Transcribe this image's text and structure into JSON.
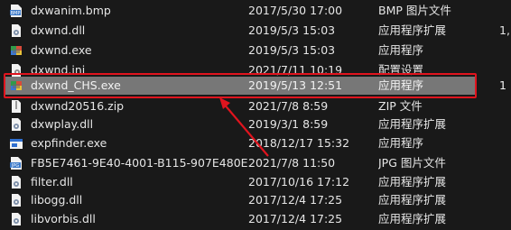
{
  "files": [
    {
      "name": "dxwanim.bmp",
      "date": "2017/5/30 17:00",
      "type": "BMP 图片文件",
      "size": "",
      "icon": "bmp-icon"
    },
    {
      "name": "dxwnd.dll",
      "date": "2019/5/3 15:03",
      "type": "应用程序扩展",
      "size": "1,",
      "icon": "dll-icon"
    },
    {
      "name": "dxwnd.exe",
      "date": "2019/5/3 15:03",
      "type": "应用程序",
      "size": "",
      "icon": "exe-app-icon"
    },
    {
      "name": "dxwnd.ini",
      "date": "2021/7/11 10:19",
      "type": "配置设置",
      "size": "",
      "icon": "ini-icon"
    },
    {
      "name": "dxwnd_CHS.exe",
      "date": "2019/5/13 12:51",
      "type": "应用程序",
      "size": "1",
      "icon": "exe-app-icon"
    },
    {
      "name": "dxwnd20516.zip",
      "date": "2021/7/8 8:59",
      "type": "ZIP 文件",
      "size": "",
      "icon": "zip-icon"
    },
    {
      "name": "dxwplay.dll",
      "date": "2019/3/1 8:59",
      "type": "应用程序扩展",
      "size": "",
      "icon": "dll-icon"
    },
    {
      "name": "expfinder.exe",
      "date": "2018/12/17 15:32",
      "type": "应用程序",
      "size": "",
      "icon": "exe-window-icon"
    },
    {
      "name": "FB5E7461-9E40-4001-B115-907E480E...",
      "date": "2021/7/8 11:50",
      "type": "JPG 图片文件",
      "size": "",
      "icon": "jpg-icon"
    },
    {
      "name": "filter.dll",
      "date": "2017/10/16 17:12",
      "type": "应用程序扩展",
      "size": "",
      "icon": "dll-icon"
    },
    {
      "name": "libogg.dll",
      "date": "2017/12/4 17:25",
      "type": "应用程序扩展",
      "size": "",
      "icon": "dll-icon"
    },
    {
      "name": "libvorbis.dll",
      "date": "2017/12/4 17:25",
      "type": "应用程序扩展",
      "size": "",
      "icon": "dll-icon"
    }
  ],
  "selected_index": 4,
  "colors": {
    "background": "#191919",
    "text": "#e6e6e6",
    "selected_row": "#777777",
    "annotation_red": "#e0141e"
  }
}
